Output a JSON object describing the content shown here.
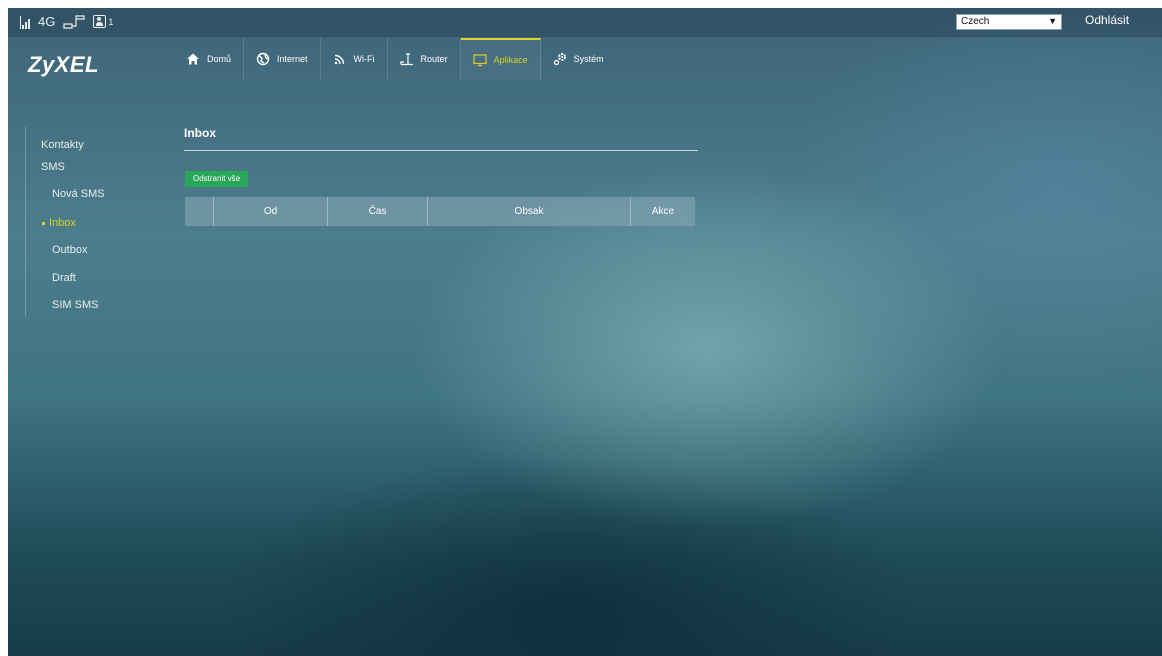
{
  "status_bar": {
    "network": "4G",
    "user_count": "1",
    "language": "Czech",
    "logout_label": "Odhlásit"
  },
  "brand": {
    "logo_text": "ZyXEL"
  },
  "nav": {
    "items": [
      {
        "label": "Domů",
        "icon": "home-icon"
      },
      {
        "label": "Internet",
        "icon": "globe-icon"
      },
      {
        "label": "Wi-Fi",
        "icon": "wifi-icon"
      },
      {
        "label": "Router",
        "icon": "router-icon"
      },
      {
        "label": "Aplikace",
        "icon": "monitor-icon",
        "active": true
      },
      {
        "label": "Systém",
        "icon": "gear-icon"
      }
    ],
    "accent_color": "#d9d32a"
  },
  "sidebar": {
    "items": [
      {
        "label": "Kontakty"
      },
      {
        "label": "SMS"
      },
      {
        "label": "Nová SMS"
      },
      {
        "label": "Inbox",
        "active": true
      },
      {
        "label": "Outbox"
      },
      {
        "label": "Draft"
      },
      {
        "label": "SIM SMS"
      }
    ]
  },
  "main": {
    "title": "Inbox",
    "delete_all_label": "Odstranit vše",
    "table": {
      "columns": [
        "",
        "Od",
        "Čas",
        "Obsak",
        "Akce"
      ],
      "rows": []
    },
    "button_color": "#2aa65a"
  }
}
